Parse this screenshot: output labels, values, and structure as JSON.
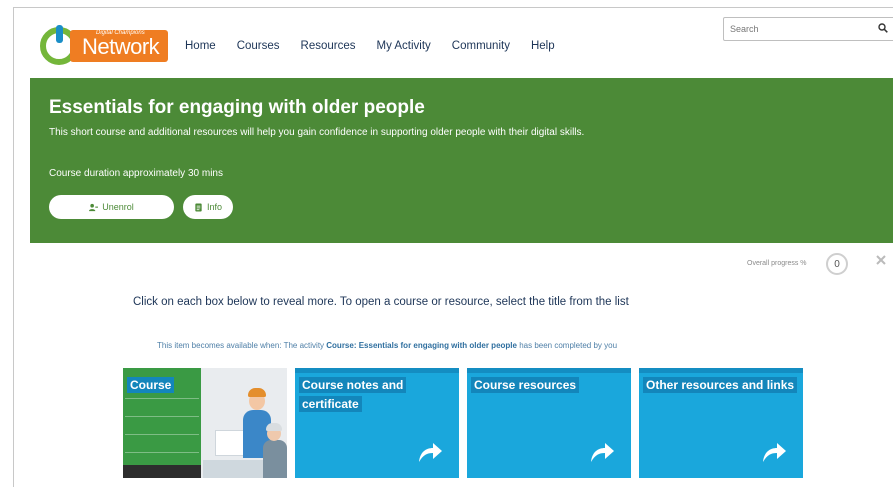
{
  "brand": {
    "small": "Digital Champions",
    "name": "Network"
  },
  "nav": [
    "Home",
    "Courses",
    "Resources",
    "My Activity",
    "Community",
    "Help"
  ],
  "search": {
    "placeholder": "Search"
  },
  "banner": {
    "title": "Essentials for engaging with older people",
    "description": "This short course and additional resources will help you gain confidence in supporting older people with their digital skills.",
    "duration": "Course duration approximately 30 mins",
    "unenrol_label": "Unenrol",
    "info_label": "Info"
  },
  "progress": {
    "label": "Overall progress %",
    "value": "0"
  },
  "instructions": "Click on each box below to reveal more. To open a course or resource, select the title from the list",
  "availability": {
    "prefix": "This item becomes available when: The activity ",
    "activity": "Course: Essentials for engaging with older people",
    "suffix": " has been completed by you"
  },
  "tiles": [
    {
      "label": "Course"
    },
    {
      "label": "Course notes and certificate"
    },
    {
      "label": "Course resources"
    },
    {
      "label": "Other resources and links"
    }
  ],
  "colors": {
    "banner": "#4c8a37",
    "tile": "#1aa7dc",
    "brand_orange": "#ef7d22",
    "brand_green": "#74b63a",
    "nav_text": "#1d3557"
  },
  "icons": {
    "search": "magnifier-icon",
    "unenrol": "user-minus-icon",
    "info": "info-document-icon",
    "close": "close-icon",
    "tile_arrow": "share-arrow-icon"
  }
}
